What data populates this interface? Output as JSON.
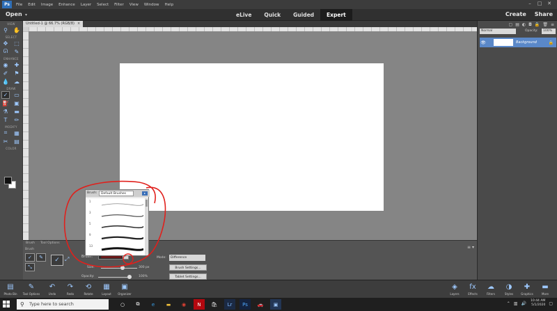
{
  "menubar": {
    "logo": "Ps",
    "items": [
      "File",
      "Edit",
      "Image",
      "Enhance",
      "Layer",
      "Select",
      "Filter",
      "View",
      "Window",
      "Help"
    ],
    "window_controls": [
      "–",
      "□",
      "✕"
    ]
  },
  "modebar": {
    "open_label": "Open",
    "modes": [
      "eLive",
      "Quick",
      "Guided",
      "Expert"
    ],
    "active_mode": "Expert",
    "create_label": "Create",
    "share_label": "Share"
  },
  "document": {
    "tab_label": "Untitled-1 @ 66.7% (RGB/8)",
    "close_label": "×"
  },
  "toolbox": {
    "sections": [
      "VIEW",
      "SELECT",
      "ENHANCE",
      "DRAW",
      "MODIFY",
      "COLOR"
    ]
  },
  "layers": {
    "blend_mode": "Normal",
    "opacity_label": "Opacity:",
    "opacity_value": "100%",
    "layer_name": "Background"
  },
  "tool_options": {
    "tabs": [
      "Brush",
      "Tool Options"
    ],
    "group_label": "Brush",
    "brush_label": "Brush:",
    "size_label": "Size:",
    "size_value": "300 px",
    "size_fraction": 0.6,
    "opacity_label": "Opacity:",
    "opacity_value": "100%",
    "opacity_fraction": 1.0,
    "mode_label": "Mode:",
    "mode_value": "Difference",
    "brush_settings_label": "Brush Settings...",
    "tablet_settings_label": "Tablet Settings..."
  },
  "brush_picker": {
    "library_label": "Brush:",
    "library_value": "Default Brushes",
    "brush_sizes": [
      "1",
      "3",
      "5",
      "9",
      "13"
    ]
  },
  "panelbar": {
    "left": [
      "Photo Bin",
      "Tool Options",
      "Undo",
      "Redo",
      "Rotate",
      "Layout",
      "Organizer"
    ],
    "right": [
      "Layers",
      "Effects",
      "Filters",
      "Styles",
      "Graphics",
      "More"
    ]
  },
  "taskbar": {
    "search_placeholder": "Type here to search",
    "time": "10:44 AM",
    "date": "5/1/2020"
  },
  "colors": {
    "accent": "#5a88c8",
    "annotation": "#e0201c",
    "canvas_bg": "#858585"
  }
}
